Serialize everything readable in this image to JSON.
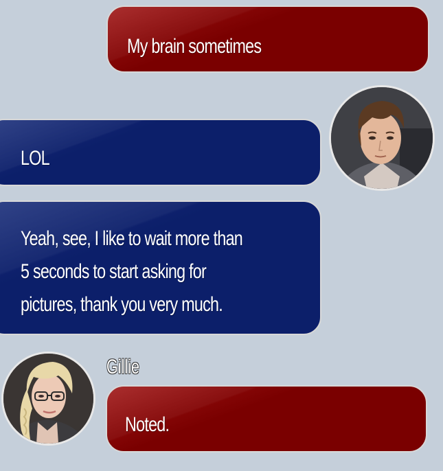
{
  "messages": [
    {
      "side": "right",
      "speaker": "",
      "text": "My brain sometimes",
      "color": "#7a0000"
    },
    {
      "side": "left",
      "speaker": "",
      "text": "LOL",
      "color": "#0c1f6a"
    },
    {
      "side": "left",
      "speaker": "",
      "lines": [
        "Yeah, see, I like to wait more than",
        "5 seconds to start asking for",
        "pictures, thank you very much."
      ],
      "color": "#0c1f6a"
    },
    {
      "side": "right",
      "speaker": "Gillie",
      "text": "Noted.",
      "color": "#7a0000"
    }
  ],
  "avatars": {
    "male": "male-character-portrait",
    "female": "blonde-woman-with-glasses-portrait"
  },
  "theme": {
    "background": "#c5cfda",
    "red_bubble": "#7a0000",
    "blue_bubble": "#0c1f6a"
  }
}
